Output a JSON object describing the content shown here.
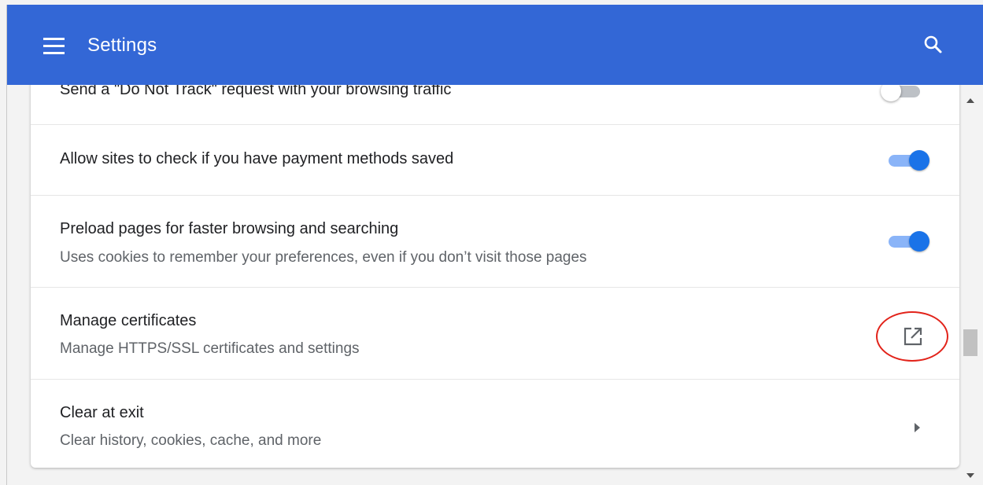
{
  "header": {
    "title": "Settings",
    "background_color": "#3367d6",
    "menu_icon": "hamburger-menu-icon",
    "search_icon": "search-icon"
  },
  "settings": [
    {
      "title": "Send a \"Do Not Track\" request with your browsing traffic",
      "control": "toggle",
      "enabled": false
    },
    {
      "title": "Allow sites to check if you have payment methods saved",
      "control": "toggle",
      "enabled": true
    },
    {
      "title": "Preload pages for faster browsing and searching",
      "subtitle": "Uses cookies to remember your preferences, even if you don’t visit those pages",
      "control": "toggle",
      "enabled": true
    },
    {
      "title": "Manage certificates",
      "subtitle": "Manage HTTPS/SSL certificates and settings",
      "control": "external-link",
      "icon": "open-in-new-icon",
      "highlighted": true,
      "highlight_color": "#e2231a"
    },
    {
      "title": "Clear at exit",
      "subtitle": "Clear history, cookies, cache, and more",
      "control": "submenu-arrow",
      "icon": "arrow-right-icon"
    }
  ],
  "colors": {
    "accent": "#1a73e8",
    "toggle_track_on": "#8ab4f8",
    "text_primary": "#202124",
    "text_secondary": "#5f6368"
  }
}
